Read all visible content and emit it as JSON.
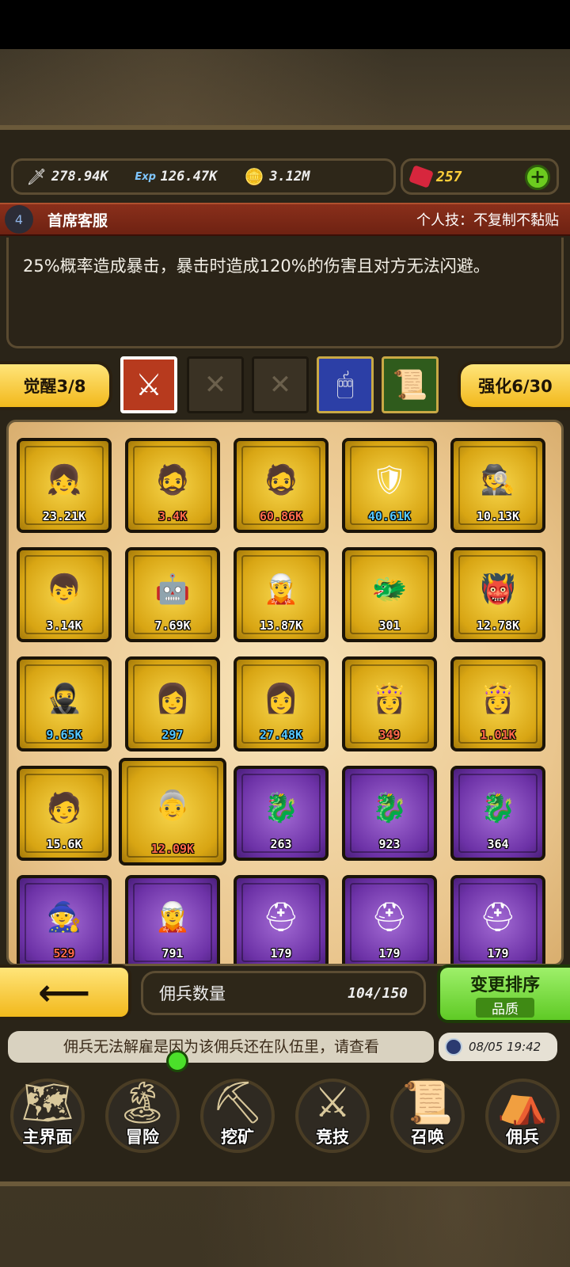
{
  "resources": [
    {
      "icon": "sword-icon",
      "glyph": "🗡",
      "value": "278.94K"
    },
    {
      "icon": "exp-icon",
      "glyph": "Exp",
      "value": "126.47K"
    },
    {
      "icon": "gold-icon",
      "glyph": "🪙",
      "value": "3.12M"
    }
  ],
  "gems": {
    "icon": "ruby-icon",
    "value": "257",
    "plus": "+"
  },
  "skill": {
    "level": "4",
    "name": "首席客服",
    "type": "个人技：不复制不黏贴",
    "description": "25%概率造成暴击，暴击时造成120%的伤害且对方无法闪避。"
  },
  "awaken": {
    "label": "觉醒3/8"
  },
  "enhance": {
    "label": "强化6/30"
  },
  "slots": [
    "sword-slash-icon",
    "x-icon",
    "x-icon",
    "mouse-icon",
    "scroll-icon"
  ],
  "cards": [
    {
      "frame": "gold",
      "hero": "👧",
      "val": "23.21K",
      "color": "white"
    },
    {
      "frame": "gold",
      "hero": "🧔",
      "val": "3.4K",
      "color": "red"
    },
    {
      "frame": "gold",
      "hero": "🧔",
      "val": "60.86K",
      "color": "red"
    },
    {
      "frame": "gold",
      "hero": "🛡",
      "val": "40.61K",
      "color": "blue"
    },
    {
      "frame": "gold",
      "hero": "🕵",
      "val": "10.13K",
      "color": "white"
    },
    {
      "frame": "gold",
      "hero": "👦",
      "val": "3.14K",
      "color": "white"
    },
    {
      "frame": "gold",
      "hero": "🤖",
      "val": "7.69K",
      "color": "white"
    },
    {
      "frame": "gold",
      "hero": "🧝",
      "val": "13.87K",
      "color": "white"
    },
    {
      "frame": "gold",
      "hero": "🐲",
      "val": "301",
      "color": "white"
    },
    {
      "frame": "gold",
      "hero": "👹",
      "val": "12.78K",
      "color": "white"
    },
    {
      "frame": "gold",
      "hero": "🥷",
      "val": "9.65K",
      "color": "blue"
    },
    {
      "frame": "gold",
      "hero": "👩",
      "val": "297",
      "color": "blue"
    },
    {
      "frame": "gold",
      "hero": "👩",
      "val": "27.48K",
      "color": "blue"
    },
    {
      "frame": "gold",
      "hero": "👸",
      "val": "349",
      "color": "red"
    },
    {
      "frame": "gold",
      "hero": "👸",
      "val": "1.01K",
      "color": "red"
    },
    {
      "frame": "gold",
      "hero": "🧑",
      "val": "15.6K",
      "color": "white"
    },
    {
      "frame": "gold",
      "hero": "👵",
      "val": "12.09K",
      "color": "red"
    },
    {
      "frame": "purple",
      "hero": "🐉",
      "val": "263",
      "color": "white"
    },
    {
      "frame": "purple",
      "hero": "🐉",
      "val": "923",
      "color": "white"
    },
    {
      "frame": "purple",
      "hero": "🐉",
      "val": "364",
      "color": "white"
    },
    {
      "frame": "purple",
      "hero": "🧙",
      "val": "529",
      "color": "red"
    },
    {
      "frame": "purple",
      "hero": "🧝",
      "val": "791",
      "color": "white"
    },
    {
      "frame": "purple",
      "hero": "⛑",
      "val": "179",
      "color": "white"
    },
    {
      "frame": "purple",
      "hero": "⛑",
      "val": "179",
      "color": "white"
    },
    {
      "frame": "purple",
      "hero": "⛑",
      "val": "179",
      "color": "white"
    }
  ],
  "bottom": {
    "back": "⟵",
    "count_label": "佣兵数量",
    "count": "104/150",
    "sort_title": "变更排序",
    "sort_sub": "品质"
  },
  "ticker": "佣兵无法解雇是因为该佣兵还在队伍里，请查看",
  "clock": "08/05 19:42",
  "nav": [
    {
      "icon": "map-icon",
      "glyph": "🗺",
      "label": "主界面"
    },
    {
      "icon": "island-icon",
      "glyph": "🏝",
      "label": "冒险"
    },
    {
      "icon": "pickaxe-icon",
      "glyph": "⛏",
      "label": "挖矿"
    },
    {
      "icon": "crossed-swords-icon",
      "glyph": "⚔",
      "label": "竞技"
    },
    {
      "icon": "summon-scroll-icon",
      "glyph": "📜",
      "label": "召唤"
    },
    {
      "icon": "tent-icon",
      "glyph": "⛺",
      "label": "佣兵"
    }
  ]
}
